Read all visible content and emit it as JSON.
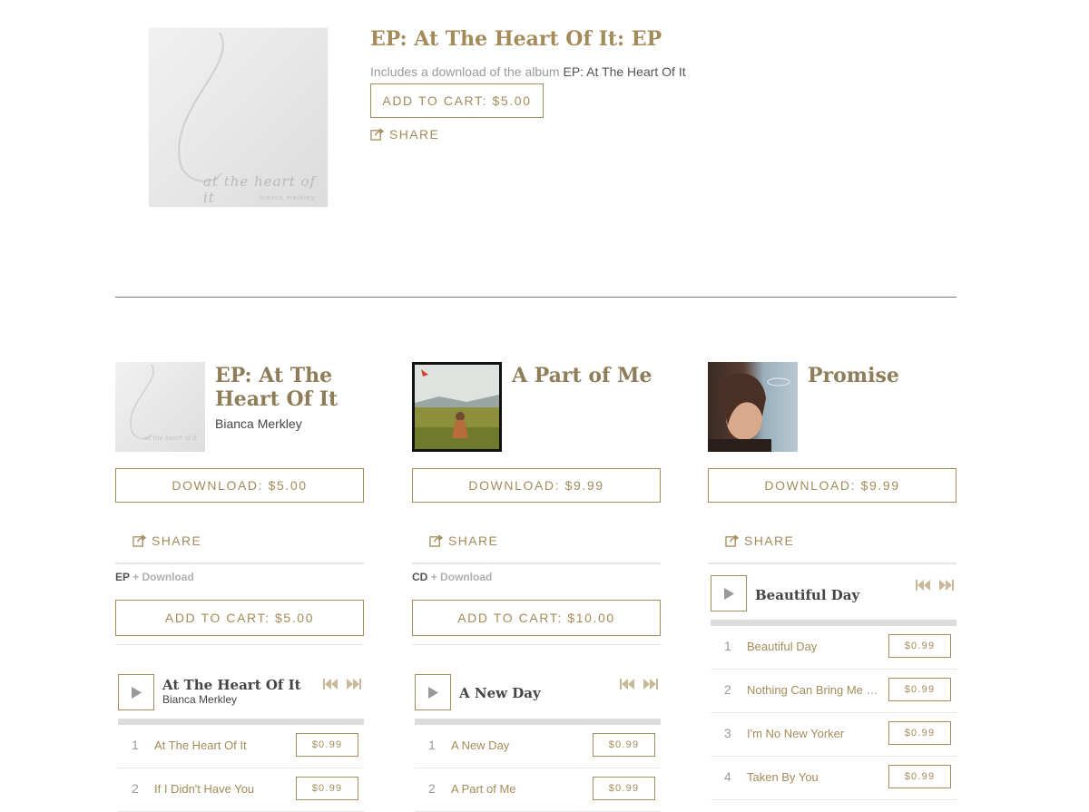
{
  "feature": {
    "title": "EP: At The Heart Of It: EP",
    "includes_prefix": "Includes a download of the album",
    "includes_album": "EP: At The Heart Of It",
    "cart_label": "ADD TO CART: $5.00",
    "share_label": "SHARE",
    "cover_script": "at the heart of it",
    "cover_artist": "bianca merkley"
  },
  "albums": [
    {
      "title": "EP: At The Heart Of It",
      "artist": "Bianca Merkley",
      "download_label": "DOWNLOAD: $5.00",
      "share_label": "SHARE",
      "format": "EP",
      "format_extra": "+ Download",
      "cart_label": "ADD TO CART: $5.00",
      "player": {
        "track": "At The Heart Of It",
        "artist": "Bianca Merkley"
      },
      "tracks": [
        {
          "num": "1",
          "name": "At The Heart Of It",
          "price": "$0.99"
        },
        {
          "num": "2",
          "name": "If I Didn't Have You",
          "price": "$0.99"
        }
      ]
    },
    {
      "title": "A Part of Me",
      "artist": "",
      "download_label": "DOWNLOAD: $9.99",
      "share_label": "SHARE",
      "format": "CD",
      "format_extra": "+ Download",
      "cart_label": "ADD TO CART: $10.00",
      "player": {
        "track": "A New Day",
        "artist": ""
      },
      "tracks": [
        {
          "num": "1",
          "name": "A New Day",
          "price": "$0.99"
        },
        {
          "num": "2",
          "name": "A Part of Me",
          "price": "$0.99"
        }
      ]
    },
    {
      "title": "Promise",
      "artist": "",
      "download_label": "DOWNLOAD: $9.99",
      "share_label": "SHARE",
      "player": {
        "track": "Beautiful Day",
        "artist": ""
      },
      "tracks": [
        {
          "num": "1",
          "name": "Beautiful Day",
          "price": "$0.99"
        },
        {
          "num": "2",
          "name": "Nothing Can Bring Me D...",
          "price": "$0.99"
        },
        {
          "num": "3",
          "name": "I'm No New Yorker",
          "price": "$0.99"
        },
        {
          "num": "4",
          "name": "Taken By You",
          "price": "$0.99"
        }
      ]
    }
  ],
  "colors": {
    "accent": "#a48b5a",
    "rule": "#e5e5e5",
    "progress": "#dcdcdc"
  },
  "icons": [
    "share-icon",
    "play-icon",
    "skip-back-icon",
    "skip-forward-icon"
  ]
}
